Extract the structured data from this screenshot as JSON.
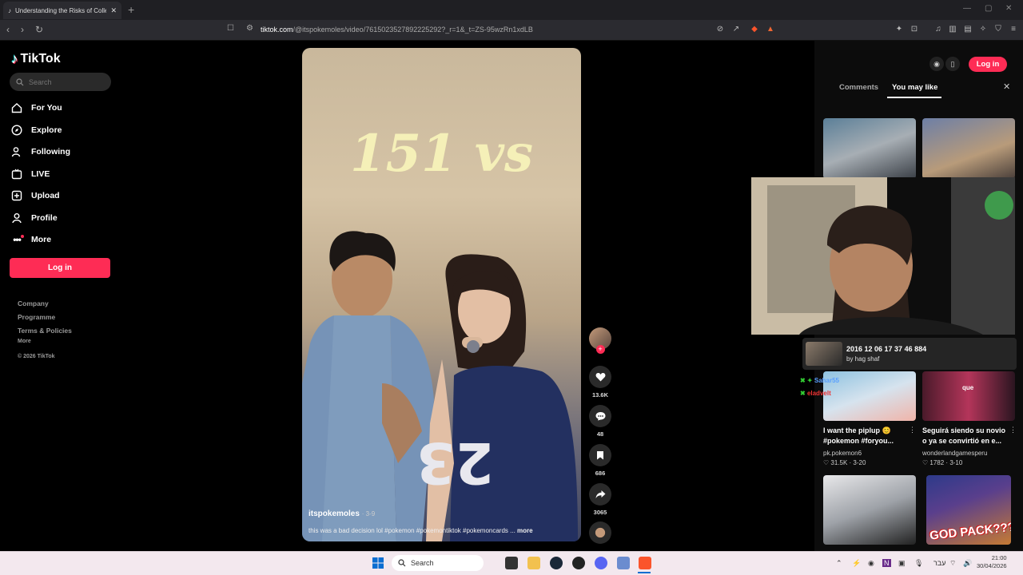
{
  "browser": {
    "tab_title": "Understanding the Risks of Colle",
    "url_domain": "tiktok.com",
    "url_path": "/@itspokemoles/video/7615023527892225292?_r=1&_t=ZS-95wzRn1xdLB"
  },
  "sidebar": {
    "logo": "TikTok",
    "search_placeholder": "Search",
    "items": [
      {
        "label": "For You",
        "icon": "home-icon"
      },
      {
        "label": "Explore",
        "icon": "compass-icon"
      },
      {
        "label": "Following",
        "icon": "user-icon"
      },
      {
        "label": "LIVE",
        "icon": "live-icon"
      },
      {
        "label": "Upload",
        "icon": "plus-square-icon"
      },
      {
        "label": "Profile",
        "icon": "profile-icon"
      },
      {
        "label": "More",
        "icon": "more-icon"
      }
    ],
    "login_label": "Log in",
    "footer": [
      "Company",
      "Programme",
      "Terms & Policies",
      "More",
      "© 2026 TikTok"
    ]
  },
  "video": {
    "overlay_title": "151 vs",
    "author": "itspokemoles",
    "date": "· 3-9",
    "caption": "this was a bad decision lol #pokemon #pokemontiktok #pokemoncards ...",
    "more_label": "more",
    "jersey_number": "23",
    "likes": "13.6K",
    "comments": "48",
    "saves": "686",
    "shares": "3065"
  },
  "right_panel": {
    "login_label": "Log in",
    "tab_comments": "Comments",
    "tab_you_may_like": "You may like",
    "recommendations": [
      {
        "title": "I want the piplup 😊 #pokemon #foryou...",
        "user": "pk.pokemon6",
        "likes": "31.5K",
        "date": "3-20"
      },
      {
        "title": "Seguirá siendo su novio o ya se convirtió en e...",
        "user": "wonderlandgamesperu",
        "likes": "1782",
        "date": "3-10"
      }
    ],
    "thumb_caption": "que",
    "god_pack_text": "GOD PACK???"
  },
  "overlay": {
    "now_playing_title": "2016 12 06 17 37 46 884",
    "now_playing_by": "by hag shaf",
    "chat_names": [
      "Sahar55",
      "eladvelt"
    ]
  },
  "taskbar": {
    "search_label": "Search",
    "lang": "עבר",
    "time": "21:00",
    "date": "30/04/2026"
  },
  "colors": {
    "accent": "#fe2c55",
    "background": "#000000",
    "taskbar": "#f3e8ee"
  }
}
